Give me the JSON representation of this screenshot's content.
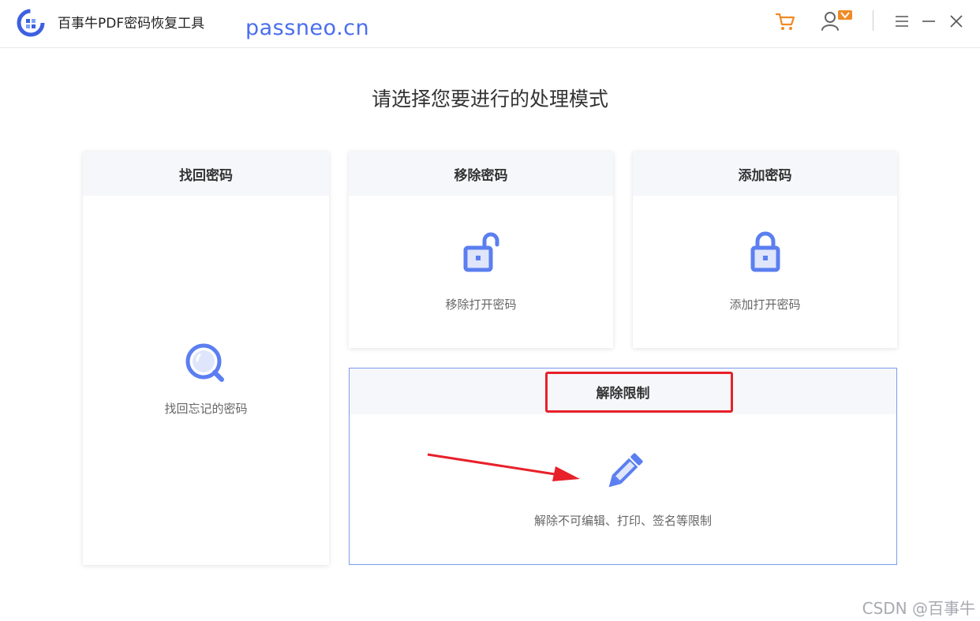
{
  "app": {
    "title": "百事牛PDF密码恢复工具",
    "watermark_domain": "passneo.cn",
    "accent_color": "#4a6ef0"
  },
  "toolbar": {
    "cart_icon": "cart-icon",
    "user_icon": "user-vip-icon",
    "menu_icon": "menu-icon",
    "minimize_icon": "minimize-icon",
    "close_icon": "close-icon"
  },
  "main": {
    "heading": "请选择您要进行的处理模式",
    "cards": {
      "find": {
        "title": "找回密码",
        "desc": "找回忘记的密码",
        "icon": "magnifier-icon"
      },
      "remove": {
        "title": "移除密码",
        "desc": "移除打开密码",
        "icon": "unlocked-padlock-icon"
      },
      "add": {
        "title": "添加密码",
        "desc": "添加打开密码",
        "icon": "locked-padlock-icon"
      },
      "unlock": {
        "title": "解除限制",
        "desc": "解除不可编辑、打印、签名等限制",
        "icon": "pencil-icon"
      }
    }
  },
  "annotation": {
    "highlight_color": "#e8202a"
  },
  "watermark": {
    "text": "CSDN @百事牛"
  }
}
